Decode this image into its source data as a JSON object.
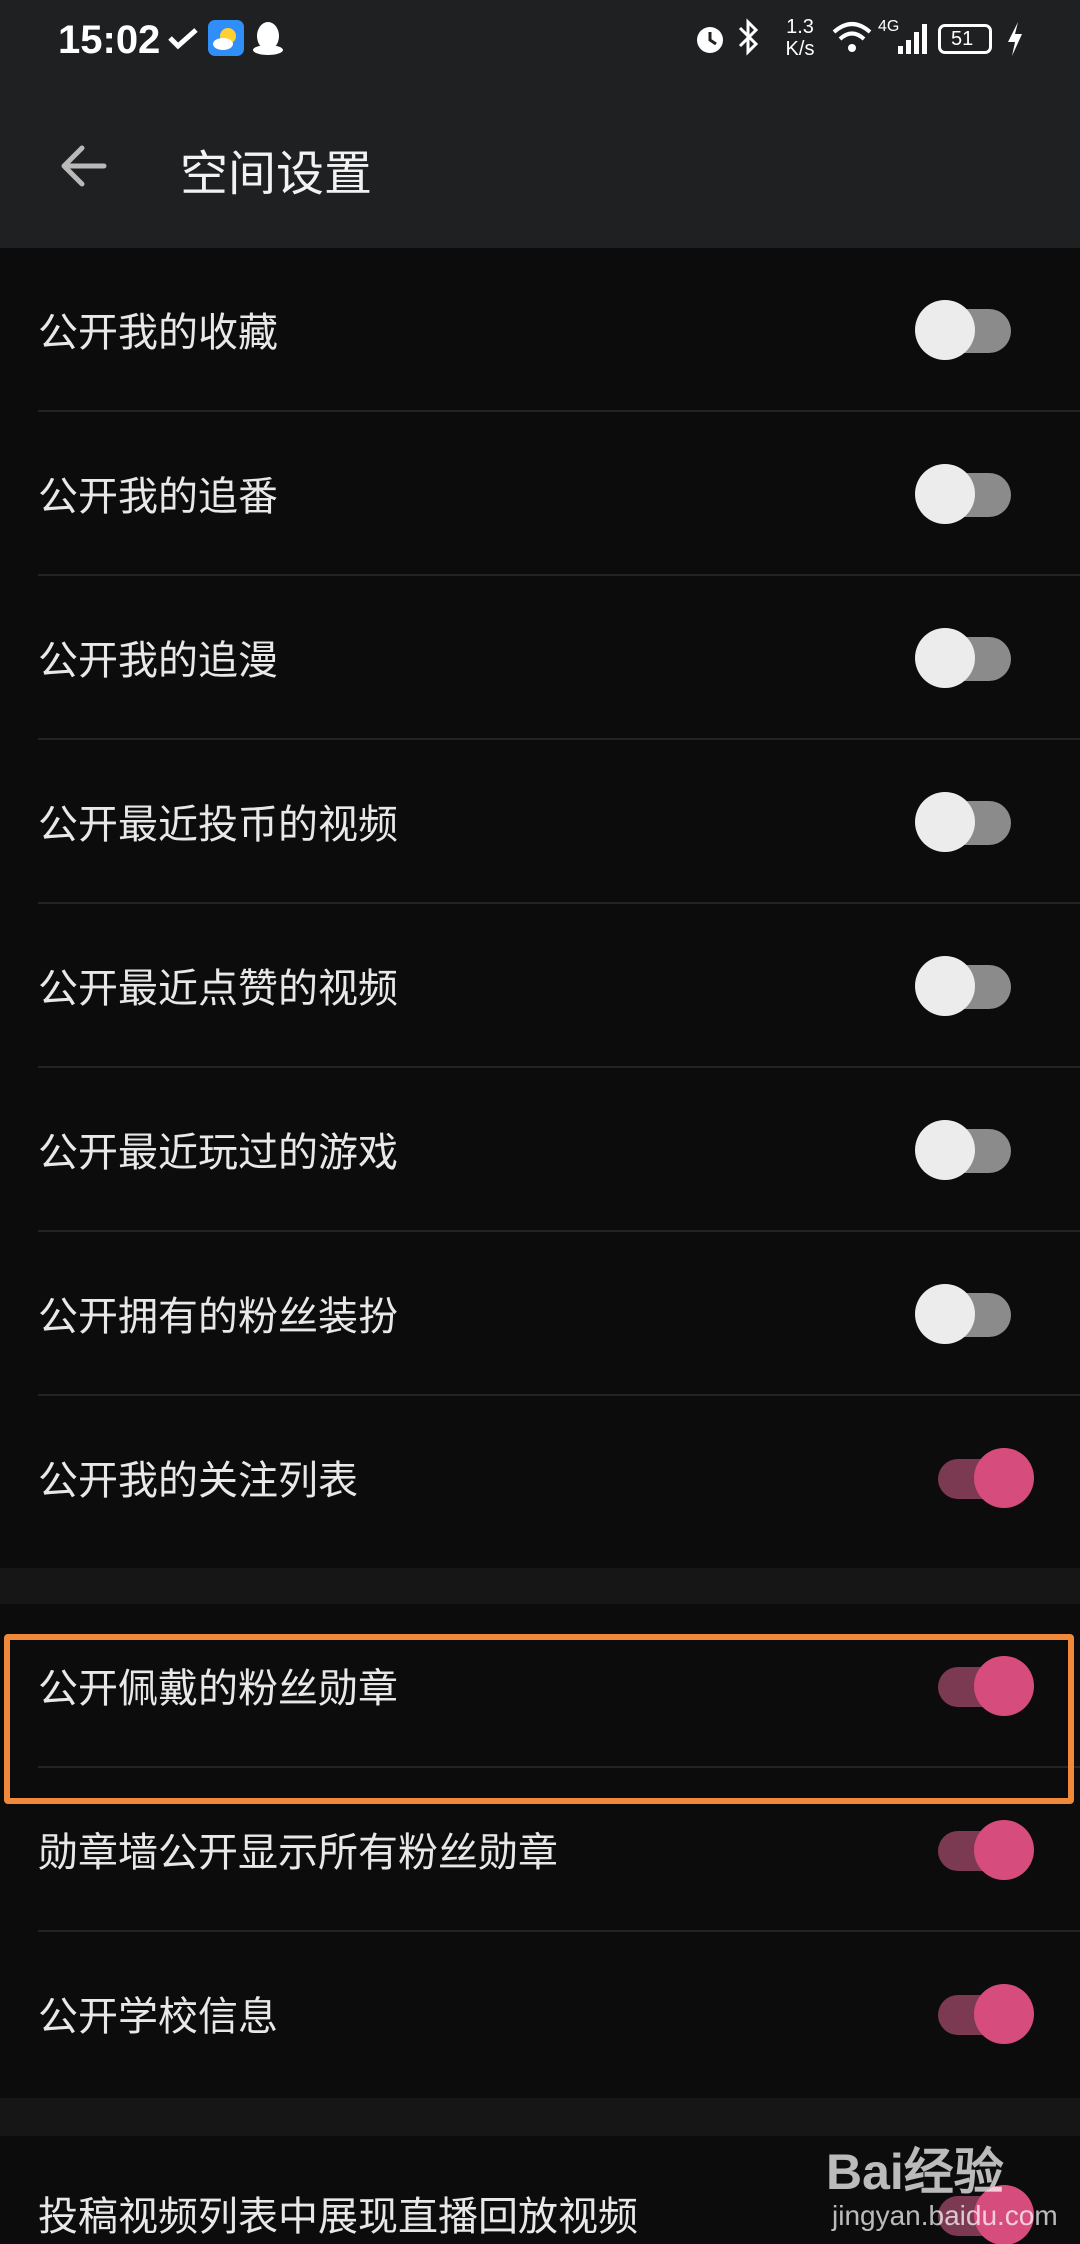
{
  "status_bar": {
    "time": "15:02",
    "net_speed_top": "1.3",
    "net_speed_bottom": "K/s",
    "network": "4G",
    "battery": "51"
  },
  "header": {
    "title": "空间设置",
    "back_icon": "arrow-left-icon"
  },
  "sections": [
    {
      "rows": [
        {
          "label": "公开我的收藏",
          "enabled": false
        },
        {
          "label": "公开我的追番",
          "enabled": false
        },
        {
          "label": "公开我的追漫",
          "enabled": false
        },
        {
          "label": "公开最近投币的视频",
          "enabled": false
        },
        {
          "label": "公开最近点赞的视频",
          "enabled": false
        },
        {
          "label": "公开最近玩过的游戏",
          "enabled": false
        },
        {
          "label": "公开拥有的粉丝装扮",
          "enabled": false
        },
        {
          "label": "公开我的关注列表",
          "enabled": true
        }
      ]
    },
    {
      "rows": [
        {
          "label": "公开佩戴的粉丝勋章",
          "enabled": true
        },
        {
          "label": "勋章墙公开显示所有粉丝勋章",
          "enabled": true
        },
        {
          "label": "公开学校信息",
          "enabled": true
        }
      ]
    },
    {
      "rows": [
        {
          "label": "投稿视频列表中展现直播回放视频",
          "enabled": true
        }
      ]
    }
  ],
  "colors": {
    "accent": "#d64c7c",
    "highlight": "#f08a3a",
    "background": "#0c0c0c"
  },
  "watermark": {
    "main": "Bai经验",
    "sub": "jingyan.baidu.com"
  }
}
